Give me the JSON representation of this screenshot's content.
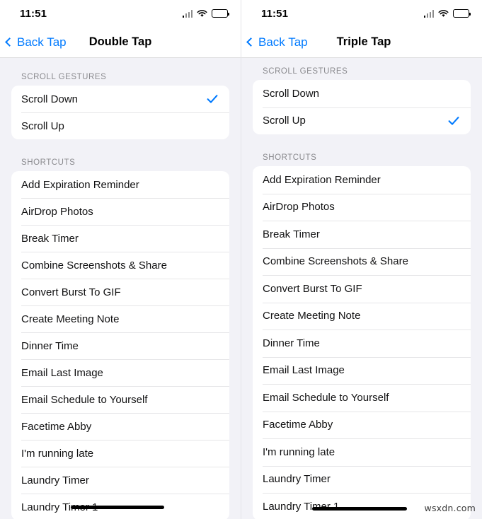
{
  "panels": [
    {
      "id": "double-tap",
      "status": {
        "time": "11:51",
        "signal_icon": "cellular-signal-icon",
        "wifi_icon": "wifi-icon",
        "battery_icon": "battery-icon"
      },
      "nav": {
        "back_label": "Back Tap",
        "back_icon": "chevron-left-icon",
        "title": "Double Tap"
      },
      "scroll_section": {
        "header": "SCROLL GESTURES",
        "items": [
          {
            "label": "Scroll Down",
            "selected": true
          },
          {
            "label": "Scroll Up",
            "selected": false
          }
        ]
      },
      "shortcuts_section": {
        "header": "SHORTCUTS",
        "items": [
          {
            "label": "Add Expiration Reminder",
            "selected": false
          },
          {
            "label": "AirDrop Photos",
            "selected": false
          },
          {
            "label": "Break Timer",
            "selected": false
          },
          {
            "label": "Combine Screenshots & Share",
            "selected": false
          },
          {
            "label": "Convert Burst To GIF",
            "selected": false
          },
          {
            "label": "Create Meeting Note",
            "selected": false
          },
          {
            "label": "Dinner Time",
            "selected": false
          },
          {
            "label": "Email Last Image",
            "selected": false
          },
          {
            "label": "Email Schedule to Yourself",
            "selected": false
          },
          {
            "label": "Facetime Abby",
            "selected": false
          },
          {
            "label": "I'm running late",
            "selected": false
          },
          {
            "label": "Laundry Timer",
            "selected": false
          },
          {
            "label": "Laundry Timer 1",
            "selected": false
          }
        ]
      }
    },
    {
      "id": "triple-tap",
      "status": {
        "time": "11:51",
        "signal_icon": "cellular-signal-icon",
        "wifi_icon": "wifi-icon",
        "battery_icon": "battery-icon"
      },
      "nav": {
        "back_label": "Back Tap",
        "back_icon": "chevron-left-icon",
        "title": "Triple Tap"
      },
      "scroll_section": {
        "header": "SCROLL GESTURES",
        "items": [
          {
            "label": "Scroll Down",
            "selected": false
          },
          {
            "label": "Scroll Up",
            "selected": true
          }
        ]
      },
      "shortcuts_section": {
        "header": "SHORTCUTS",
        "items": [
          {
            "label": "Add Expiration Reminder",
            "selected": false
          },
          {
            "label": "AirDrop Photos",
            "selected": false
          },
          {
            "label": "Break Timer",
            "selected": false
          },
          {
            "label": "Combine Screenshots & Share",
            "selected": false
          },
          {
            "label": "Convert Burst To GIF",
            "selected": false
          },
          {
            "label": "Create Meeting Note",
            "selected": false
          },
          {
            "label": "Dinner Time",
            "selected": false
          },
          {
            "label": "Email Last Image",
            "selected": false
          },
          {
            "label": "Email Schedule to Yourself",
            "selected": false
          },
          {
            "label": "Facetime Abby",
            "selected": false
          },
          {
            "label": "I'm running late",
            "selected": false
          },
          {
            "label": "Laundry Timer",
            "selected": false
          },
          {
            "label": "Laundry Timer 1",
            "selected": false
          }
        ]
      }
    }
  ],
  "watermark": "wsxdn.com",
  "colors": {
    "accent": "#007aff",
    "page_background": "#f2f2f7",
    "card_background": "#ffffff",
    "section_header": "#8a8a8e",
    "label": "#111112",
    "separator": "#e6e6e8"
  }
}
